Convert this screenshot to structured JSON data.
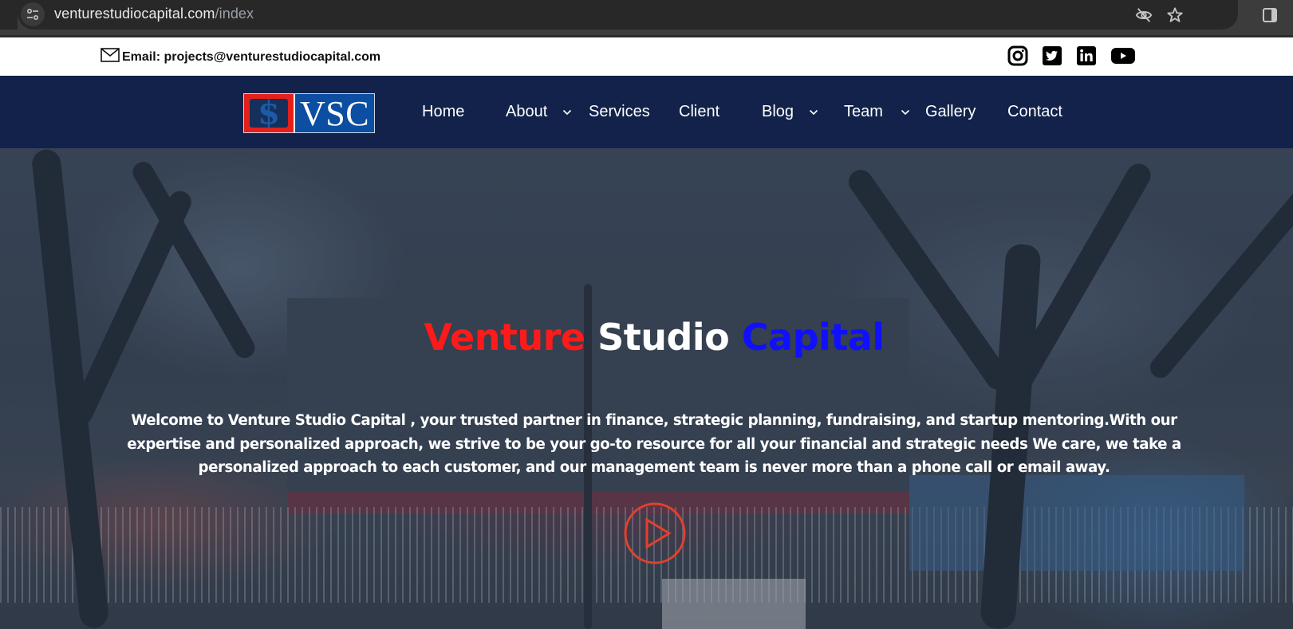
{
  "browser": {
    "url_domain": "venturestudiocapital.com",
    "url_path": "/index",
    "icons": [
      "site-info-icon",
      "eye-off-icon",
      "star-icon",
      "side-panel-icon"
    ]
  },
  "topbar": {
    "email_icon": "mail-icon",
    "email_text": "Email: projects@venturestudiocapital.com",
    "socials": [
      {
        "name": "instagram",
        "icon": "instagram-icon"
      },
      {
        "name": "twitter",
        "icon": "twitter-icon"
      },
      {
        "name": "linkedin",
        "icon": "linkedin-icon"
      },
      {
        "name": "youtube",
        "icon": "youtube-icon"
      }
    ]
  },
  "navbar": {
    "logo_symbol": "$",
    "logo_text": "VSC",
    "items": [
      {
        "label": "Home",
        "dropdown": false
      },
      {
        "label": "About",
        "dropdown": true
      },
      {
        "label": "Services",
        "dropdown": false
      },
      {
        "label": "Client",
        "dropdown": false
      },
      {
        "label": "Blog",
        "dropdown": true
      },
      {
        "label": "Team",
        "dropdown": true
      },
      {
        "label": "Gallery",
        "dropdown": false
      },
      {
        "label": "Contact",
        "dropdown": false
      }
    ]
  },
  "hero": {
    "title_part1": "Venture",
    "title_part2": "Studio",
    "title_part3": "Capital",
    "colors": {
      "part1": "#ff1a1a",
      "part2": "#ffffff",
      "part3": "#1010ff",
      "play": "#e0412e"
    },
    "description": "Welcome to Venture Studio Capital , your trusted partner in finance, strategic planning, fundraising, and startup mentoring.With our expertise and personalized approach, we strive to be your go-to resource for all your financial and strategic needs We care, we take a personalized approach to each customer, and our management team is never more than a phone call or email away.",
    "play_icon": "play-icon"
  }
}
